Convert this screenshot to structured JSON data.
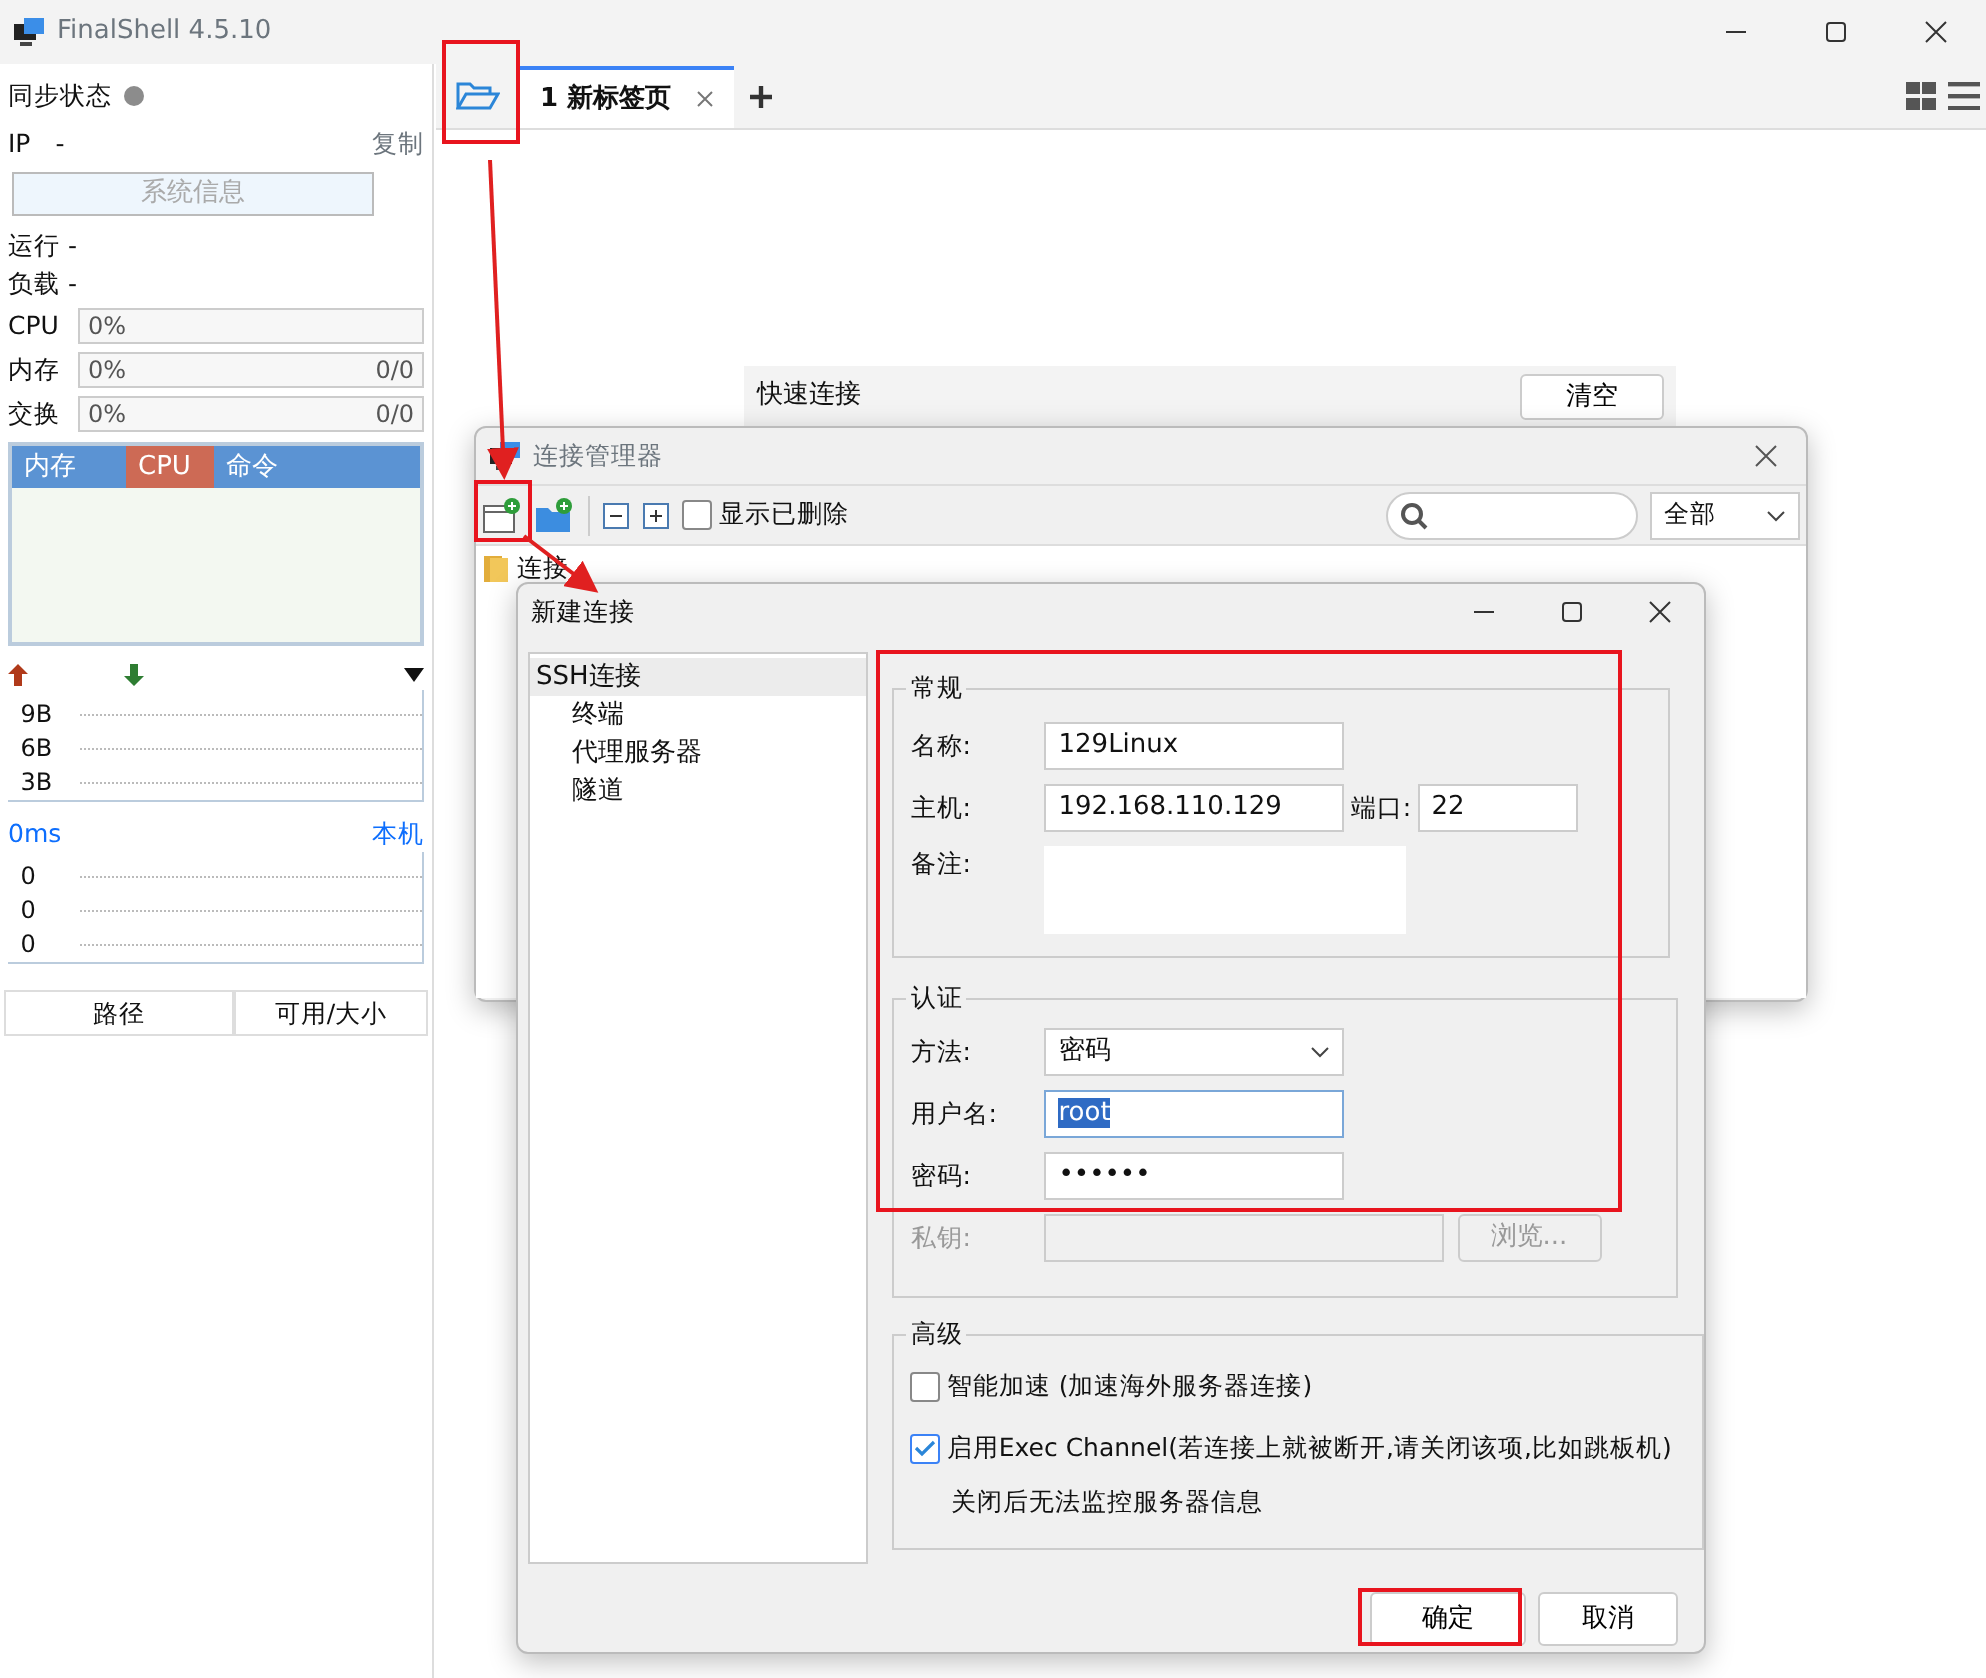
{
  "app": {
    "title": "FinalShell 4.5.10"
  },
  "sidebar": {
    "sync_label": "同步状态",
    "ip_label": "IP",
    "ip_value": "-",
    "copy": "复制",
    "sysinfo_button": "系统信息",
    "uptime": "运行 -",
    "load": "负载 -",
    "meters": [
      {
        "label": "CPU",
        "percent": "0%"
      },
      {
        "label": "内存",
        "percent": "0%",
        "ratio": "0/0"
      },
      {
        "label": "交换",
        "percent": "0%",
        "ratio": "0/0"
      }
    ],
    "process_tabs": [
      {
        "label": "内存",
        "selected": false
      },
      {
        "label": "CPU",
        "selected": true
      },
      {
        "label": "命令",
        "selected": false
      }
    ],
    "net_ticks": [
      "9B",
      "6B",
      "3B"
    ],
    "ping": "0ms",
    "ping_target": "本机",
    "ping_ticks": [
      "0",
      "0",
      "0"
    ],
    "file_columns": [
      "路径",
      "可用/大小"
    ]
  },
  "tabs": [
    {
      "label": "1 新标签页",
      "selected": true
    }
  ],
  "quick_connect": {
    "title": "快速连接",
    "clear_button": "清空"
  },
  "manager": {
    "title": "连接管理器",
    "show_deleted": {
      "label": "显示已删除",
      "checked": false
    },
    "filter": "全部",
    "tree": [
      {
        "label": "连接"
      }
    ]
  },
  "dialog": {
    "title": "新建连接",
    "nav": [
      {
        "label": "SSH连接",
        "selected": true,
        "children": [
          {
            "label": "终端",
            "selected": false
          },
          {
            "label": "代理服务器",
            "selected": false
          },
          {
            "label": "隧道",
            "selected": false
          }
        ]
      }
    ],
    "general": {
      "legend": "常规",
      "name_label": "名称:",
      "name": "129Linux",
      "host_label": "主机:",
      "host": "192.168.110.129",
      "port_label": "端口:",
      "port": "22",
      "note_label": "备注:"
    },
    "auth": {
      "legend": "认证",
      "method_label": "方法:",
      "method": "密码",
      "user_label": "用户名:",
      "user": "root",
      "user_selected": true,
      "password_label": "密码:",
      "password": "••••••",
      "key_label": "私钥:",
      "key_disabled": true,
      "browse": "浏览..."
    },
    "advanced": {
      "legend": "高级",
      "options": [
        {
          "label": "智能加速 (加速海外服务器连接)",
          "checked": false
        },
        {
          "label": "启用Exec Channel(若连接上就被断开,请关闭该项,比如跳板机)",
          "checked": true
        }
      ],
      "note": "关闭后无法监控服务器信息"
    },
    "buttons": [
      "确定",
      "取消"
    ]
  }
}
